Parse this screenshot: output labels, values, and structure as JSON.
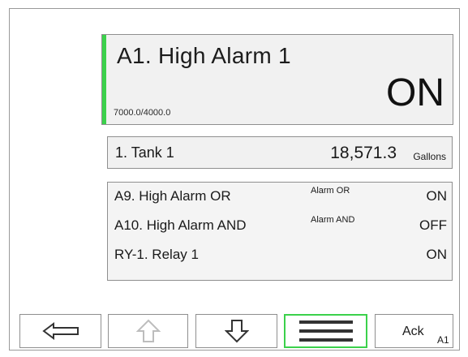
{
  "alarm": {
    "title": "A1. High Alarm 1",
    "setpoint": "7000.0/4000.0",
    "state": "ON",
    "accent_color": "#3bd14b"
  },
  "tank": {
    "name": "1. Tank 1",
    "value": "18,571.3",
    "unit": "Gallons"
  },
  "outputs": [
    {
      "label": "A9. High Alarm OR",
      "tag": "Alarm OR",
      "state": "ON"
    },
    {
      "label": "A10. High Alarm AND",
      "tag": "Alarm AND",
      "state": "OFF"
    },
    {
      "label": "RY-1. Relay 1",
      "tag": "",
      "state": "ON"
    }
  ],
  "buttons": {
    "back_icon": "left-arrow-icon",
    "up_icon": "up-arrow-icon",
    "down_icon": "down-arrow-icon",
    "menu_icon": "menu-icon",
    "ack_label": "Ack",
    "ack_sub": "A1"
  }
}
